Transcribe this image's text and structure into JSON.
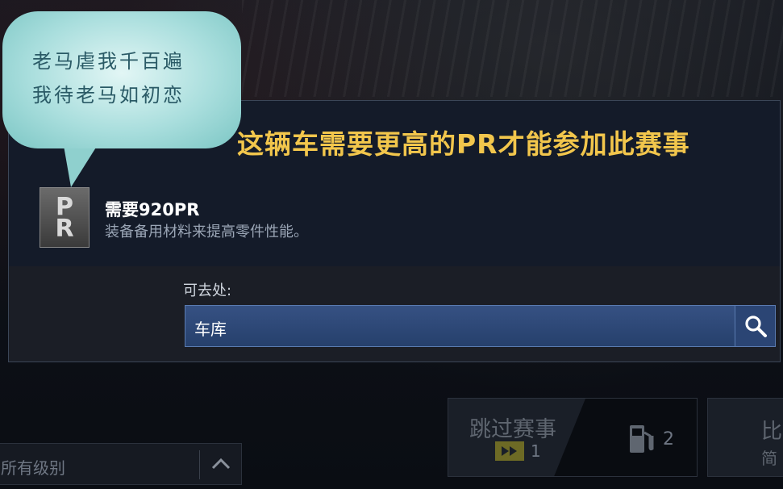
{
  "bubble": {
    "line1": "老马虐我千百遍",
    "line2": "我待老马如初恋"
  },
  "dialog": {
    "title": "这辆车需要更高的PR才能参加此赛事",
    "badge_text": "PR",
    "requirement_title": "需要920PR",
    "requirement_desc": "装备备用材料来提高零件性能。",
    "destinations_label": "可去处:",
    "destination_option": "车库"
  },
  "bottom_bar": {
    "level_filter": "所有级别",
    "skip_label": "跳过赛事",
    "skip_count": "1",
    "fuel_count": "2",
    "race_label": "比",
    "race_sub": "简"
  },
  "colors": {
    "title": "#f2c64c",
    "destination_bar": "#2f4a7a",
    "bubble": "#a9dedd"
  }
}
